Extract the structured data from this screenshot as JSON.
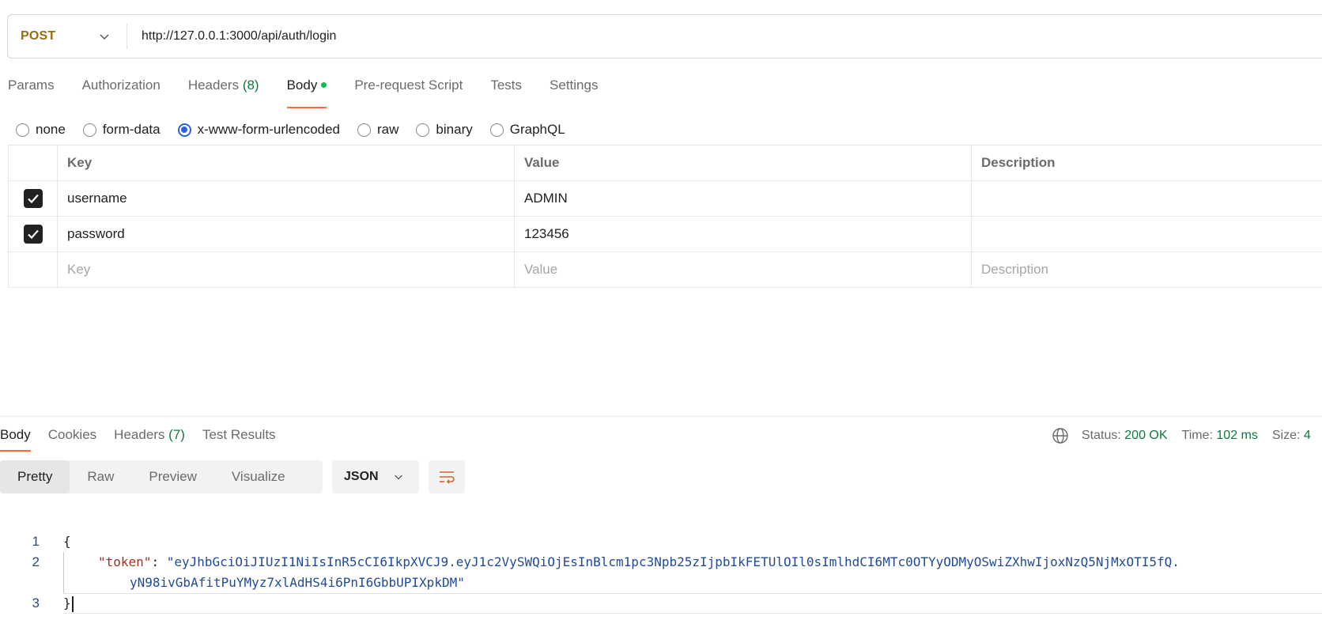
{
  "request": {
    "method": "POST",
    "url": "http://127.0.0.1:3000/api/auth/login"
  },
  "req_tabs": {
    "params": "Params",
    "authorization": "Authorization",
    "headers": "Headers",
    "headers_count": "(8)",
    "body": "Body",
    "prerequest": "Pre-request Script",
    "tests": "Tests",
    "settings": "Settings"
  },
  "body_types": {
    "none": "none",
    "form_data": "form-data",
    "urlencoded": "x-www-form-urlencoded",
    "raw": "raw",
    "binary": "binary",
    "graphql": "GraphQL",
    "selected": "x-www-form-urlencoded"
  },
  "params_table": {
    "headers": {
      "key": "Key",
      "value": "Value",
      "description": "Description"
    },
    "rows": [
      {
        "checked": true,
        "key": "username",
        "value": "ADMIN",
        "description": ""
      },
      {
        "checked": true,
        "key": "password",
        "value": "123456",
        "description": ""
      }
    ],
    "placeholder": {
      "key": "Key",
      "value": "Value",
      "description": "Description"
    }
  },
  "response": {
    "tabs": {
      "body": "Body",
      "cookies": "Cookies",
      "headers": "Headers",
      "headers_count": "(7)",
      "test_results": "Test Results"
    },
    "status_label": "Status:",
    "status_value": "200 OK",
    "time_label": "Time:",
    "time_value": "102 ms",
    "size_label": "Size:",
    "size_value": "4",
    "views": {
      "pretty": "Pretty",
      "raw": "Raw",
      "preview": "Preview",
      "visualize": "Visualize"
    },
    "format": "JSON",
    "code": {
      "line_numbers": [
        "1",
        "2",
        "3"
      ],
      "open_brace": "{",
      "key": "\"token\"",
      "colon": ": ",
      "value_part1": "\"eyJhbGciOiJIUzI1NiIsInR5cCI6IkpXVCJ9.eyJ1c2VySWQiOjEsInBlcm1pc3Npb25zIjpbIkFETUlOIl0sImlhdCI6MTc0OTYyODMyOSwiZXhwIjoxNzQ5NjMxOTI5fQ.",
      "value_part2": "yN98ivGbAfitPuYMyz7xlAdHS4i6PnI6GbbUPIXpkDM\"",
      "close_brace": "}"
    }
  },
  "colors": {
    "method": "#9a6b12",
    "accent_tab": "#ff6c37",
    "status_ok": "#0e7a3c",
    "radio_selected": "#2d62d6",
    "json_key": "#a3311f",
    "json_string": "#214b9a"
  }
}
